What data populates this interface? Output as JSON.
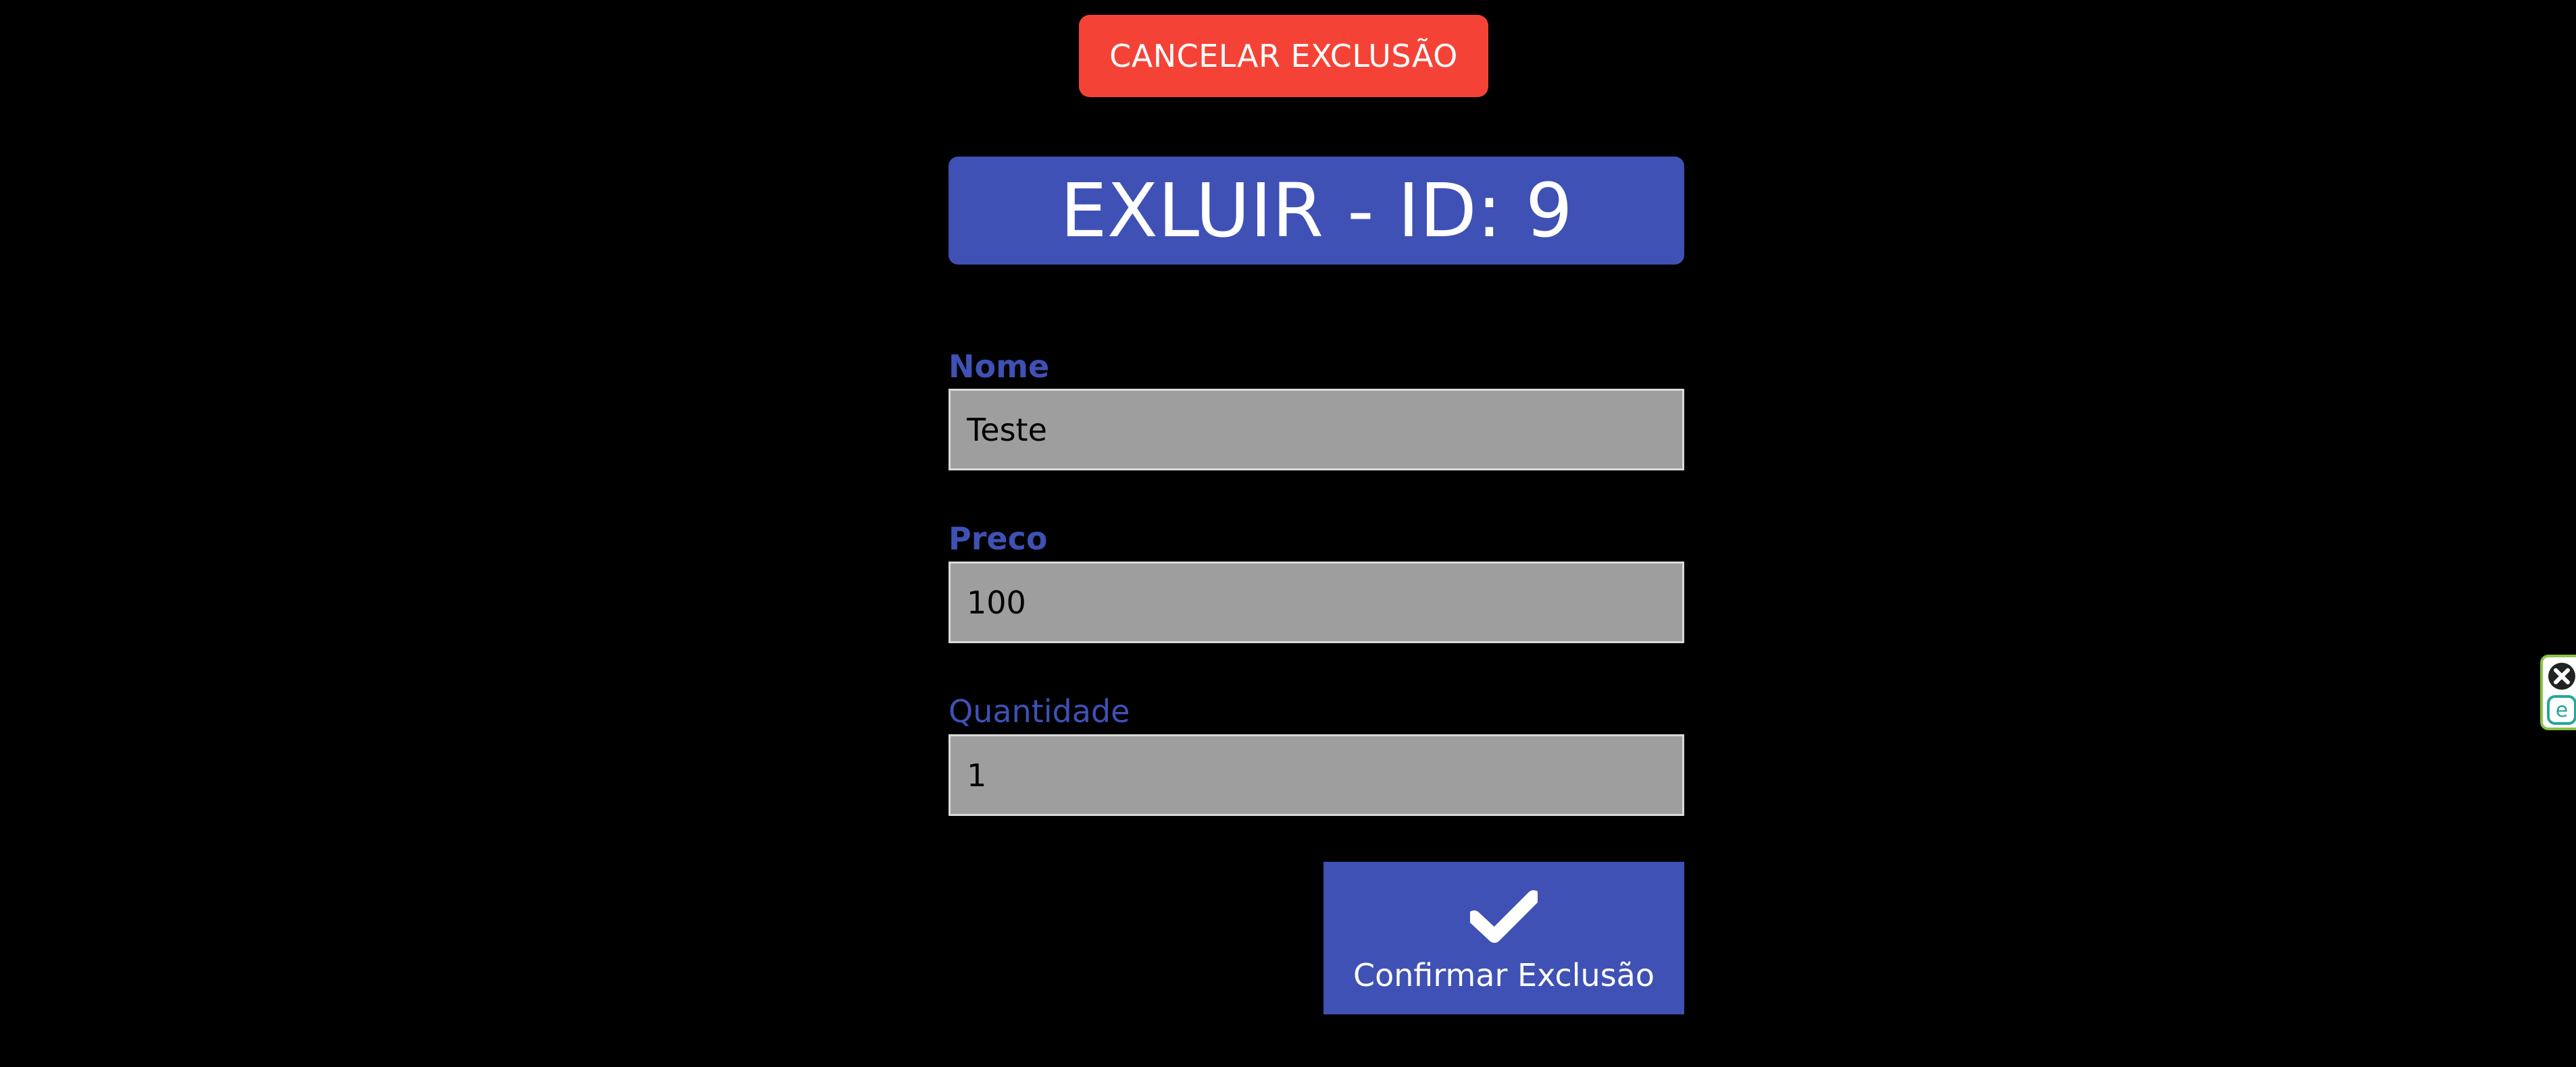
{
  "cancel_button": {
    "label": "CANCELAR EXCLUSÃO"
  },
  "header": {
    "title": "EXLUIR - ID: 9"
  },
  "form": {
    "nome": {
      "label": "Nome",
      "value": "Teste"
    },
    "preco": {
      "label": "Preco",
      "value": "100"
    },
    "quantidade": {
      "label": "Quantidade",
      "value": "1"
    }
  },
  "confirm_button": {
    "label": "Confirmar Exclusão",
    "icon": "check-icon"
  },
  "extension_widget": {
    "icons": [
      "close-icon",
      "e-icon"
    ]
  },
  "colors": {
    "background": "#000000",
    "primary": "#3f51b5",
    "danger": "#f44336",
    "input_bg": "#9e9e9e",
    "widget_border": "#8bc34a"
  }
}
